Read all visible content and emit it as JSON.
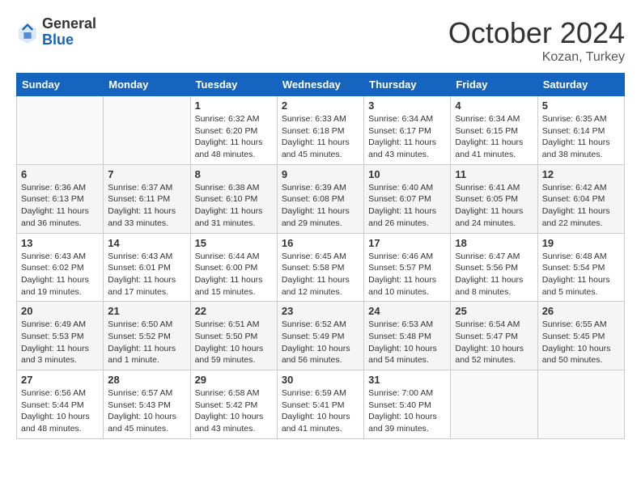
{
  "header": {
    "logo_general": "General",
    "logo_blue": "Blue",
    "month": "October 2024",
    "location": "Kozan, Turkey"
  },
  "columns": [
    "Sunday",
    "Monday",
    "Tuesday",
    "Wednesday",
    "Thursday",
    "Friday",
    "Saturday"
  ],
  "rows": [
    [
      {
        "day": "",
        "detail": ""
      },
      {
        "day": "",
        "detail": ""
      },
      {
        "day": "1",
        "detail": "Sunrise: 6:32 AM\nSunset: 6:20 PM\nDaylight: 11 hours and 48 minutes."
      },
      {
        "day": "2",
        "detail": "Sunrise: 6:33 AM\nSunset: 6:18 PM\nDaylight: 11 hours and 45 minutes."
      },
      {
        "day": "3",
        "detail": "Sunrise: 6:34 AM\nSunset: 6:17 PM\nDaylight: 11 hours and 43 minutes."
      },
      {
        "day": "4",
        "detail": "Sunrise: 6:34 AM\nSunset: 6:15 PM\nDaylight: 11 hours and 41 minutes."
      },
      {
        "day": "5",
        "detail": "Sunrise: 6:35 AM\nSunset: 6:14 PM\nDaylight: 11 hours and 38 minutes."
      }
    ],
    [
      {
        "day": "6",
        "detail": "Sunrise: 6:36 AM\nSunset: 6:13 PM\nDaylight: 11 hours and 36 minutes."
      },
      {
        "day": "7",
        "detail": "Sunrise: 6:37 AM\nSunset: 6:11 PM\nDaylight: 11 hours and 33 minutes."
      },
      {
        "day": "8",
        "detail": "Sunrise: 6:38 AM\nSunset: 6:10 PM\nDaylight: 11 hours and 31 minutes."
      },
      {
        "day": "9",
        "detail": "Sunrise: 6:39 AM\nSunset: 6:08 PM\nDaylight: 11 hours and 29 minutes."
      },
      {
        "day": "10",
        "detail": "Sunrise: 6:40 AM\nSunset: 6:07 PM\nDaylight: 11 hours and 26 minutes."
      },
      {
        "day": "11",
        "detail": "Sunrise: 6:41 AM\nSunset: 6:05 PM\nDaylight: 11 hours and 24 minutes."
      },
      {
        "day": "12",
        "detail": "Sunrise: 6:42 AM\nSunset: 6:04 PM\nDaylight: 11 hours and 22 minutes."
      }
    ],
    [
      {
        "day": "13",
        "detail": "Sunrise: 6:43 AM\nSunset: 6:02 PM\nDaylight: 11 hours and 19 minutes."
      },
      {
        "day": "14",
        "detail": "Sunrise: 6:43 AM\nSunset: 6:01 PM\nDaylight: 11 hours and 17 minutes."
      },
      {
        "day": "15",
        "detail": "Sunrise: 6:44 AM\nSunset: 6:00 PM\nDaylight: 11 hours and 15 minutes."
      },
      {
        "day": "16",
        "detail": "Sunrise: 6:45 AM\nSunset: 5:58 PM\nDaylight: 11 hours and 12 minutes."
      },
      {
        "day": "17",
        "detail": "Sunrise: 6:46 AM\nSunset: 5:57 PM\nDaylight: 11 hours and 10 minutes."
      },
      {
        "day": "18",
        "detail": "Sunrise: 6:47 AM\nSunset: 5:56 PM\nDaylight: 11 hours and 8 minutes."
      },
      {
        "day": "19",
        "detail": "Sunrise: 6:48 AM\nSunset: 5:54 PM\nDaylight: 11 hours and 5 minutes."
      }
    ],
    [
      {
        "day": "20",
        "detail": "Sunrise: 6:49 AM\nSunset: 5:53 PM\nDaylight: 11 hours and 3 minutes."
      },
      {
        "day": "21",
        "detail": "Sunrise: 6:50 AM\nSunset: 5:52 PM\nDaylight: 11 hours and 1 minute."
      },
      {
        "day": "22",
        "detail": "Sunrise: 6:51 AM\nSunset: 5:50 PM\nDaylight: 10 hours and 59 minutes."
      },
      {
        "day": "23",
        "detail": "Sunrise: 6:52 AM\nSunset: 5:49 PM\nDaylight: 10 hours and 56 minutes."
      },
      {
        "day": "24",
        "detail": "Sunrise: 6:53 AM\nSunset: 5:48 PM\nDaylight: 10 hours and 54 minutes."
      },
      {
        "day": "25",
        "detail": "Sunrise: 6:54 AM\nSunset: 5:47 PM\nDaylight: 10 hours and 52 minutes."
      },
      {
        "day": "26",
        "detail": "Sunrise: 6:55 AM\nSunset: 5:45 PM\nDaylight: 10 hours and 50 minutes."
      }
    ],
    [
      {
        "day": "27",
        "detail": "Sunrise: 6:56 AM\nSunset: 5:44 PM\nDaylight: 10 hours and 48 minutes."
      },
      {
        "day": "28",
        "detail": "Sunrise: 6:57 AM\nSunset: 5:43 PM\nDaylight: 10 hours and 45 minutes."
      },
      {
        "day": "29",
        "detail": "Sunrise: 6:58 AM\nSunset: 5:42 PM\nDaylight: 10 hours and 43 minutes."
      },
      {
        "day": "30",
        "detail": "Sunrise: 6:59 AM\nSunset: 5:41 PM\nDaylight: 10 hours and 41 minutes."
      },
      {
        "day": "31",
        "detail": "Sunrise: 7:00 AM\nSunset: 5:40 PM\nDaylight: 10 hours and 39 minutes."
      },
      {
        "day": "",
        "detail": ""
      },
      {
        "day": "",
        "detail": ""
      }
    ]
  ]
}
